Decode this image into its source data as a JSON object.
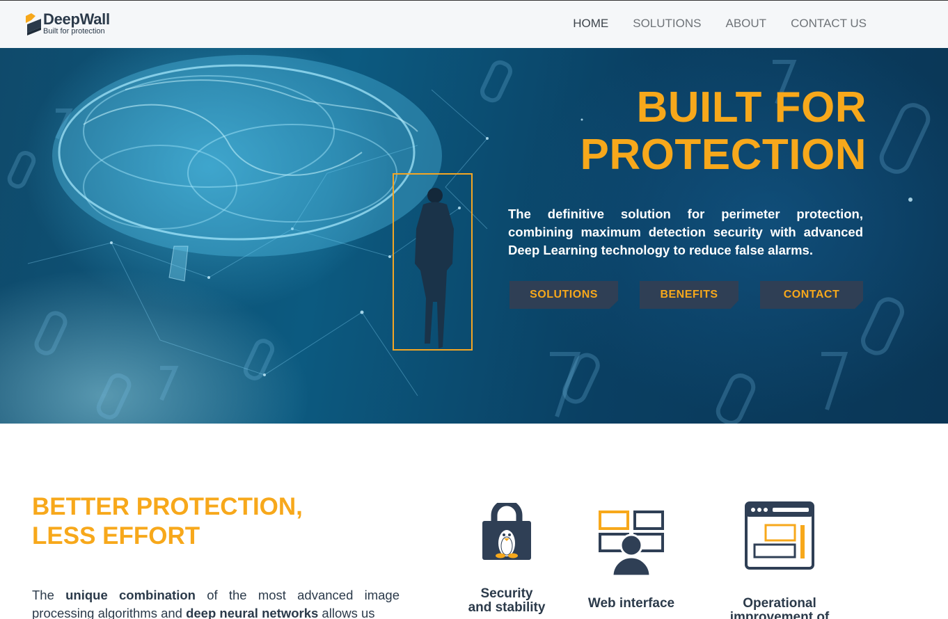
{
  "nav": {
    "logo_name": "DeepWall",
    "logo_tagline": "Built for protection",
    "links": [
      {
        "label": "HOME"
      },
      {
        "label": "SOLUTIONS"
      },
      {
        "label": "ABOUT"
      },
      {
        "label": "CONTACT US"
      }
    ]
  },
  "hero": {
    "title_line1": "BUILT FOR",
    "title_line2": "PROTECTION",
    "description": "The definitive solution for perimeter protection, combining maximum detection security with advanced Deep Learning technology to reduce false alarms.",
    "buttons": [
      {
        "label": "SOLUTIONS"
      },
      {
        "label": "BENEFITS"
      },
      {
        "label": "CONTACT"
      }
    ]
  },
  "section": {
    "title_line1": "BETTER PROTECTION,",
    "title_line2": "LESS EFFORT",
    "body_parts": [
      "The ",
      "unique combination",
      " of the most advanced image processing algorithms and ",
      "deep neural networks",
      " allows us"
    ]
  },
  "features": [
    {
      "icon": "linux-lock-icon",
      "label_line1": "Security",
      "label_line2": "and stability"
    },
    {
      "icon": "web-interface-icon",
      "label_line1": "Web interface",
      "label_line2": ""
    },
    {
      "icon": "browser-window-icon",
      "label_line1": "Operational",
      "label_line2": "improvement of"
    }
  ],
  "colors": {
    "accent": "#f7a81b",
    "dark": "#2b3a4a",
    "button_bg": "#2f3f55"
  }
}
